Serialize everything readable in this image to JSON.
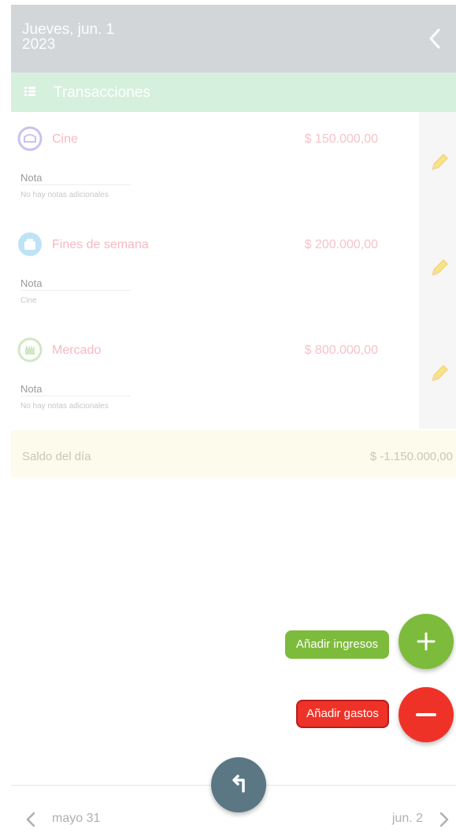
{
  "header": {
    "day_label": "Jueves, jun. 1",
    "year_label": "2023",
    "back_icon": "chevron-left-icon"
  },
  "section": {
    "title": "Transacciones",
    "icon": "list-icon"
  },
  "transactions": [
    {
      "category": "Cine",
      "amount": "$ 150.000,00",
      "note_label": "Nota",
      "note_text": "No hay notas adicionales",
      "icon": "cinema-icon",
      "icon_color": "#c9c2f0"
    },
    {
      "category": "Fines de semana",
      "amount": "$ 200.000,00",
      "note_label": "Nota",
      "note_text": "Cine",
      "icon": "weekend-icon",
      "icon_color": "#bfe3f6"
    },
    {
      "category": "Mercado",
      "amount": "$ 800.000,00",
      "note_label": "Nota",
      "note_text": "No hay notas adicionales",
      "icon": "market-icon",
      "icon_color": "#cfe8c3"
    }
  ],
  "balance": {
    "label": "Saldo del día",
    "value": "$ -1.150.000,00"
  },
  "actions": {
    "add_income_label": "Añadir ingresos",
    "add_expense_label": "Añadir gastos"
  },
  "bottom_nav": {
    "prev_label": "mayo 31",
    "next_label": "jun. 2"
  },
  "colors": {
    "header": "#d3d6d9",
    "section_bar": "#d5f0dc",
    "income": "#7dbb3c",
    "expense": "#ef3228",
    "back_fab": "#5b7784",
    "balance_bg": "#fdfbec"
  }
}
